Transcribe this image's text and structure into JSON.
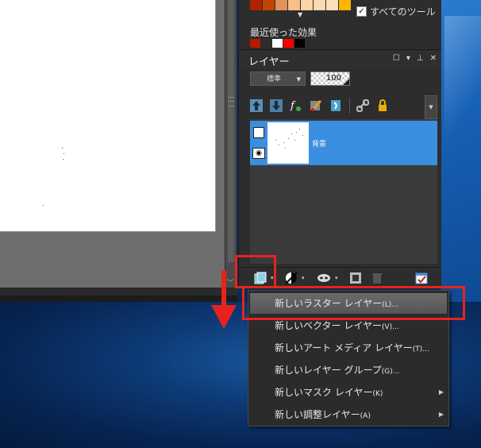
{
  "swatches": {
    "row1": [
      "#ad2300",
      "#c14400",
      "#e0925c",
      "#f7c08a",
      "#fcd4a6",
      "#fcd9b0",
      "#fbe0b9",
      "#ffb400"
    ],
    "row2": [
      "#b81900",
      "#2d2d2d",
      "#ffffff",
      "#ff0000",
      "#000000"
    ]
  },
  "all_tools_label": "すべてのツール",
  "recent_effects_label": "最近使った効果",
  "layers_panel": {
    "title": "レイヤー",
    "blend_mode": "標準",
    "opacity": "100",
    "layer_name": "背景"
  },
  "menu": {
    "items": [
      {
        "label": "新しいラスター レイヤー",
        "accel": "(L)...",
        "submenu": false,
        "selected": true
      },
      {
        "label": "新しいベクター レイヤー",
        "accel": "(V)...",
        "submenu": false,
        "selected": false
      },
      {
        "label": "新しいアート メディア レイヤー",
        "accel": "(T)...",
        "submenu": false,
        "selected": false
      },
      {
        "label": "新しいレイヤー グループ",
        "accel": "(G)...",
        "submenu": false,
        "selected": false
      },
      {
        "label": "新しいマスク レイヤー",
        "accel": "(K)",
        "submenu": true,
        "selected": false
      },
      {
        "label": "新しい調整レイヤー",
        "accel": "(A)",
        "submenu": true,
        "selected": false
      }
    ]
  },
  "colors": {
    "highlight_red": "#e8231c",
    "layer_selected": "#3b8fe0",
    "panel_bg": "#2d2d2d"
  }
}
